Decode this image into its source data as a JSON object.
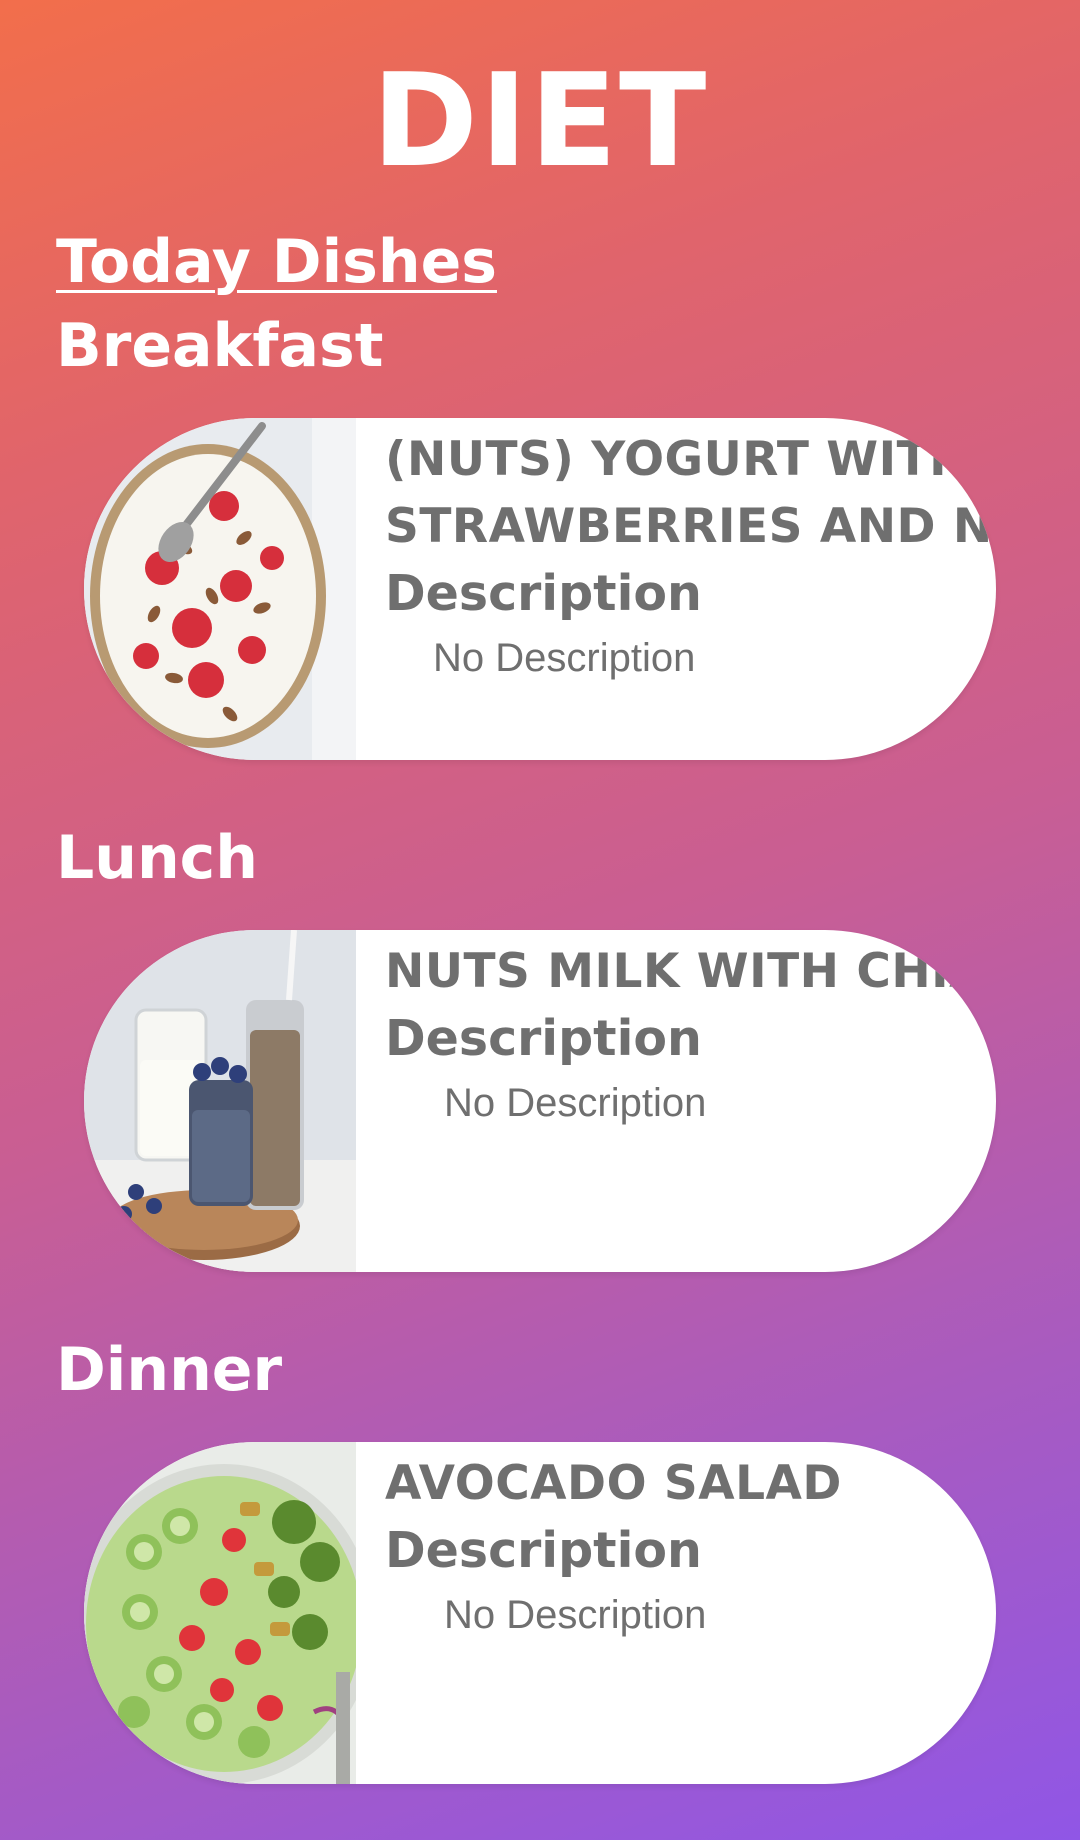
{
  "header": {
    "title": "DIET"
  },
  "today_dishes": {
    "label": "Today Dishes"
  },
  "meals": [
    {
      "section": "Breakfast",
      "dish_name": "(NUTS) YOGURT WITH\nSTRAWBERRIES AND NUTS",
      "description_label": "Description",
      "description": "No Description",
      "image_icon": "yogurt-bowl-photo"
    },
    {
      "section": "Lunch",
      "dish_name": "NUTS MILK WITH CHIA",
      "description_label": "Description",
      "description": "No Description",
      "image_icon": "chia-milk-photo"
    },
    {
      "section": "Dinner",
      "dish_name": "AVOCADO SALAD",
      "description_label": "Description",
      "description": "No Description",
      "image_icon": "avocado-salad-photo"
    }
  ],
  "colors": {
    "gradient_top": "#f26e4b",
    "gradient_bottom": "#9056e6",
    "card_background": "#ffffff",
    "card_text": "#6f6f6f",
    "heading_text": "#ffffff"
  }
}
